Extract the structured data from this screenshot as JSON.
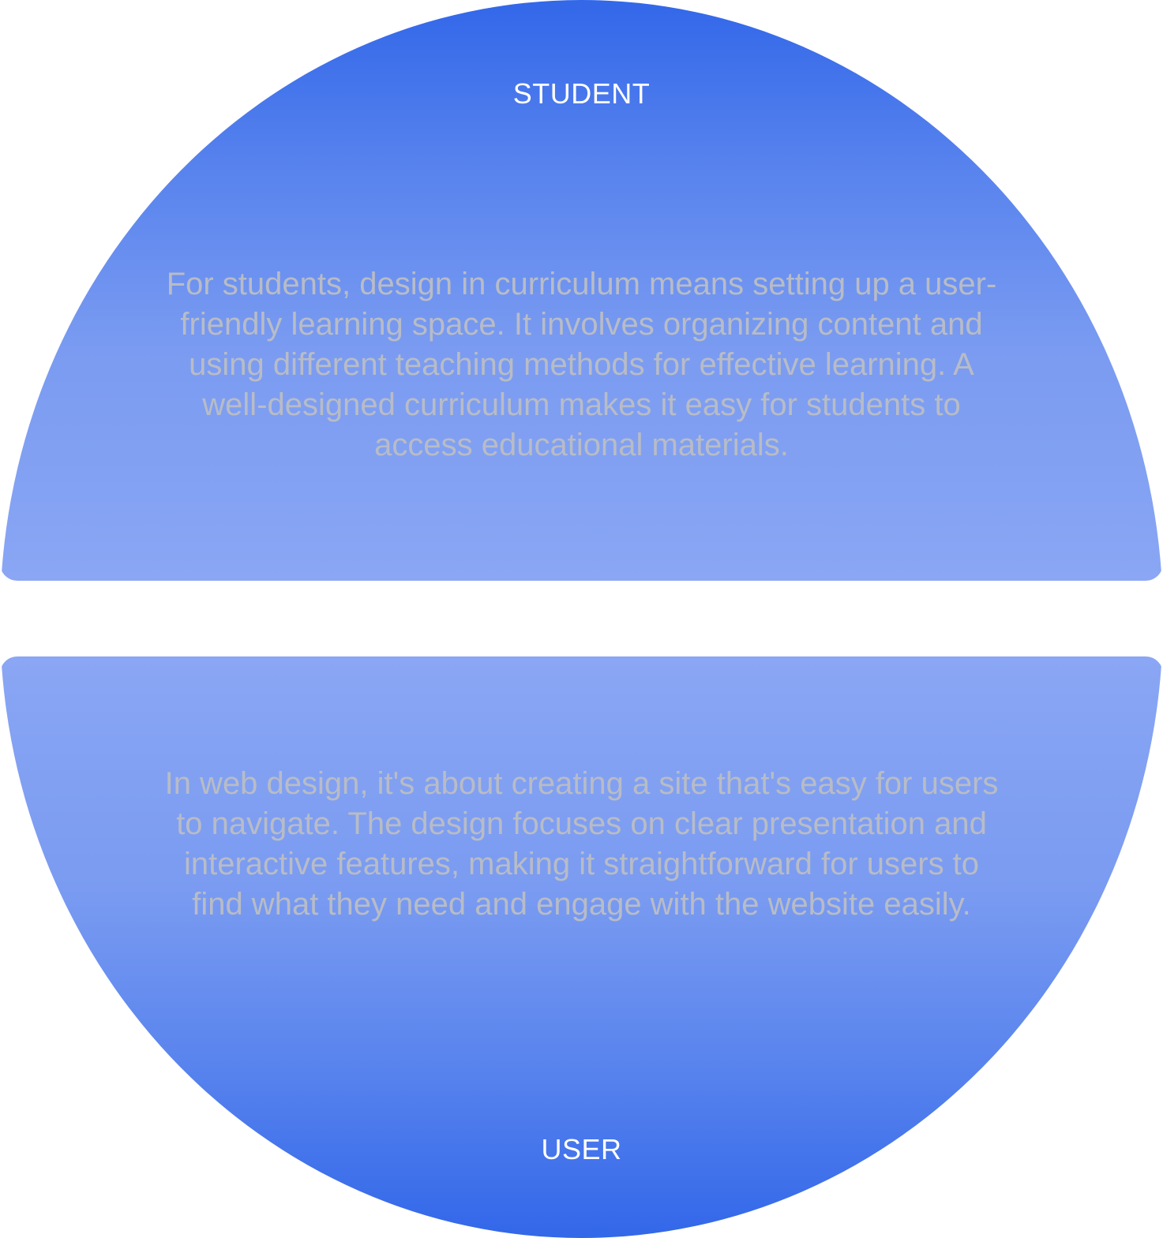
{
  "top_section": {
    "label": "STUDENT",
    "text": "For students, design in curriculum means setting up a user-friendly learning space. It involves organizing content and using different teaching methods for effective learning. A well-designed curriculum makes it easy for students to access educational materials."
  },
  "bottom_section": {
    "label": "USER",
    "text": "In web design, it's about creating a site that's easy for users to navigate. The design focuses on clear presentation and interactive features, making it straightforward for users to find what they need and engage with the website easily."
  },
  "colors": {
    "blue_deep": "#3267e9",
    "blue_light": "#8aa6f4",
    "label_text": "#ffffff",
    "body_text": "#b8bcc6"
  }
}
